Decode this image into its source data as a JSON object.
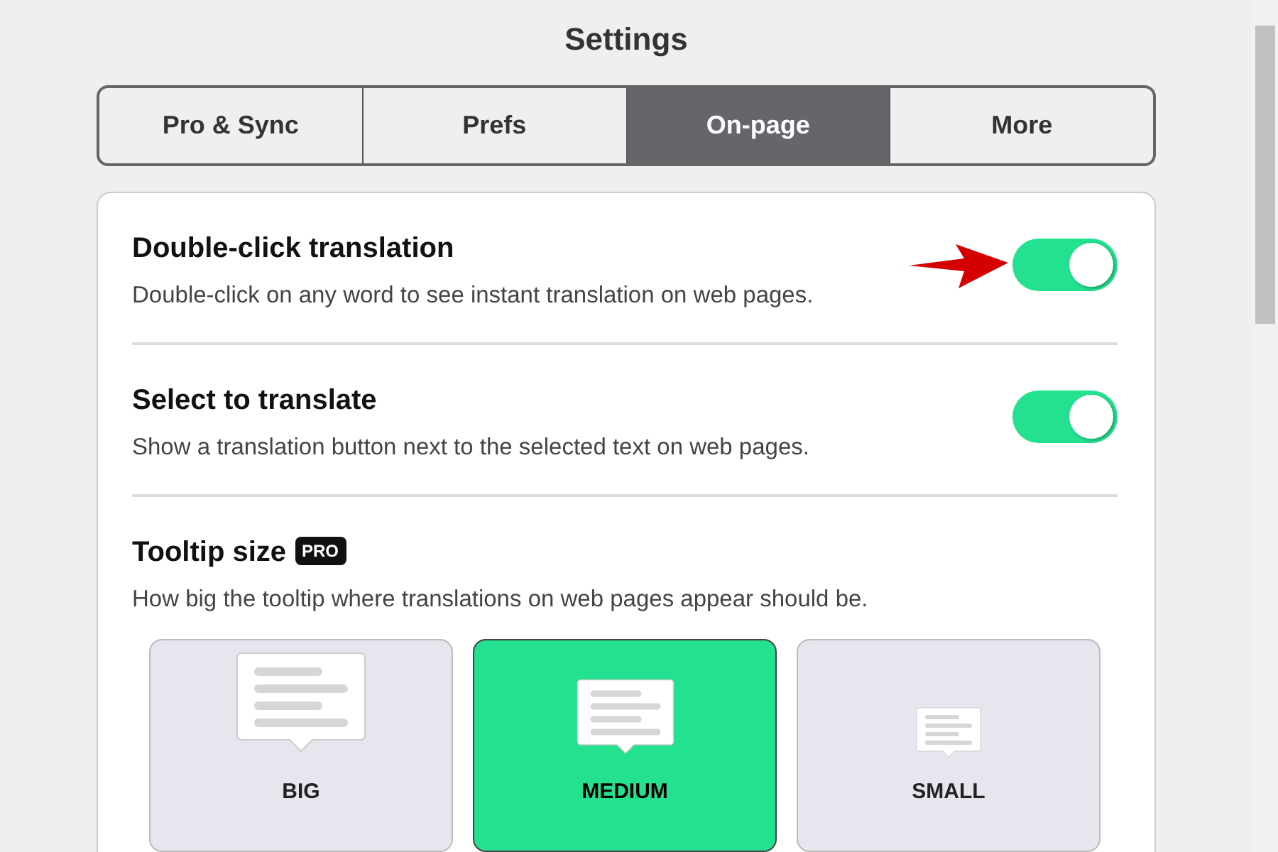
{
  "window": {
    "title": "Settings"
  },
  "tabs": [
    {
      "label": "Pro & Sync",
      "selected": false
    },
    {
      "label": "Prefs",
      "selected": false
    },
    {
      "label": "On-page",
      "selected": true
    },
    {
      "label": "More",
      "selected": false
    }
  ],
  "settings": [
    {
      "title": "Double-click translation",
      "description": "Double-click on any word to see instant translation on web pages.",
      "on": true,
      "highlighted": true
    },
    {
      "title": "Select to translate",
      "description": "Show a translation button next to the selected text on web pages.",
      "on": true,
      "highlighted": false
    }
  ],
  "tooltip_size": {
    "title": "Tooltip size",
    "badge": "PRO",
    "description": "How big the tooltip where translations on web pages appear should be.",
    "options": [
      {
        "label": "BIG",
        "kind": "big",
        "selected": false
      },
      {
        "label": "MEDIUM",
        "kind": "medium",
        "selected": true
      },
      {
        "label": "SMALL",
        "kind": "small",
        "selected": false
      }
    ]
  }
}
